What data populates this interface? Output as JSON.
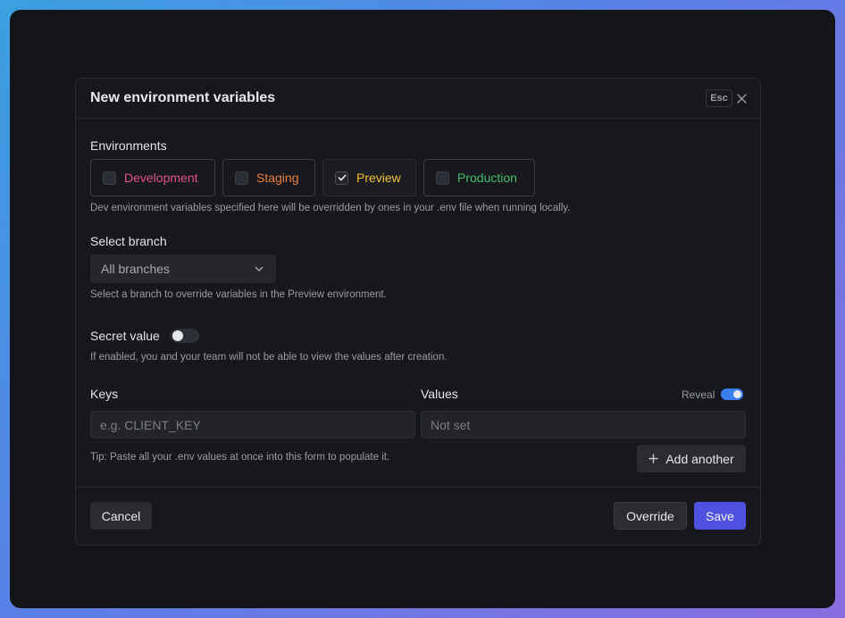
{
  "dialog": {
    "title": "New environment variables",
    "esc_label": "Esc"
  },
  "environments": {
    "label": "Environments",
    "options": [
      {
        "label": "Development",
        "color": "#e0508c",
        "checked": false
      },
      {
        "label": "Staging",
        "color": "#e8803a",
        "checked": false
      },
      {
        "label": "Preview",
        "color": "#f2c12e",
        "checked": true
      },
      {
        "label": "Production",
        "color": "#3fbf6a",
        "checked": false
      }
    ],
    "hint": "Dev environment variables specified here will be overridden by ones in your .env file when running locally."
  },
  "branch": {
    "label": "Select branch",
    "selected": "All branches",
    "hint": "Select a branch to override variables in the Preview environment."
  },
  "secret": {
    "label": "Secret value",
    "enabled": false,
    "hint": "If enabled, you and your team will not be able to view the values after creation."
  },
  "kv": {
    "keys_label": "Keys",
    "values_label": "Values",
    "reveal_label": "Reveal",
    "reveal_enabled": true,
    "key_placeholder": "e.g. CLIENT_KEY",
    "value_placeholder": "Not set",
    "tip": "Tip: Paste all your .env values at once into this form to populate it.",
    "add_label": "Add another"
  },
  "footer": {
    "cancel_label": "Cancel",
    "override_label": "Override",
    "save_label": "Save"
  },
  "colors": {
    "accent": "#4f52e0",
    "toggle_on": "#3b7ff0"
  }
}
